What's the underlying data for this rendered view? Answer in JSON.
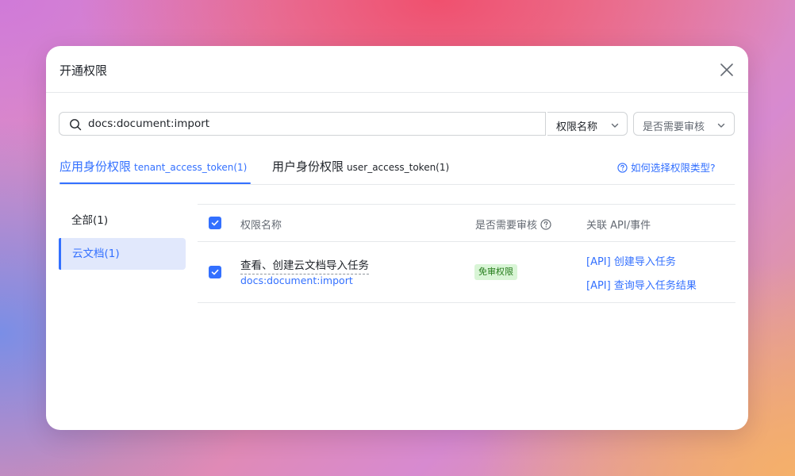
{
  "modal": {
    "title": "开通权限",
    "close_icon": "close-icon"
  },
  "search": {
    "value": "docs:document:import",
    "icon": "search-icon"
  },
  "filters": {
    "name_select": {
      "label": "权限名称",
      "icon": "chevron-down-icon"
    },
    "review_select": {
      "label": "是否需要审核",
      "icon": "chevron-down-icon"
    }
  },
  "tabs": [
    {
      "label": "应用身份权限",
      "sub": "tenant_access_token(1)",
      "active": true
    },
    {
      "label": "用户身份权限",
      "sub": "user_access_token(1)",
      "active": false
    }
  ],
  "help_link": {
    "label": "如何选择权限类型?",
    "icon": "question-circle-icon"
  },
  "categories": [
    {
      "label": "全部(1)",
      "active": false
    },
    {
      "label": "云文档(1)",
      "active": true
    }
  ],
  "table": {
    "columns": [
      "权限名称",
      "是否需要审核",
      "关联 API/事件"
    ],
    "rows": [
      {
        "checked": true,
        "name": "查看、创建云文档导入任务",
        "scope": "docs:document:import",
        "review_tag": "免审权限",
        "apis": [
          "[API] 创建导入任务",
          "[API] 查询导入任务结果"
        ]
      }
    ]
  },
  "colors": {
    "accent": "#3370ff",
    "tag_bg": "#d9f5d6",
    "tag_text": "#237b19",
    "active_category_bg": "#e1e8fc"
  }
}
